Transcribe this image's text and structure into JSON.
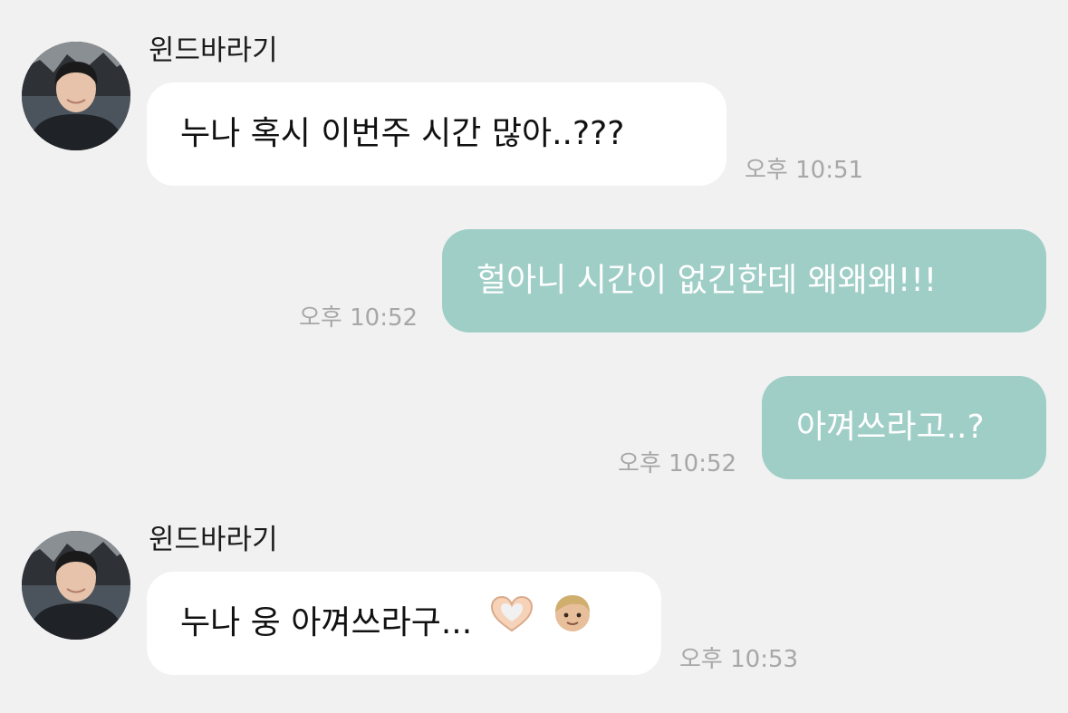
{
  "colors": {
    "background": "#f1f1f1",
    "incoming_bubble": "#ffffff",
    "outgoing_bubble": "#9fcec7",
    "timestamp": "#a7a7a7"
  },
  "messages": [
    {
      "direction": "incoming",
      "sender": "윈드바라기",
      "avatar": "profile-photo",
      "text": "누나 혹시 이번주 시간 많아..???",
      "time": "오후 10:51"
    },
    {
      "direction": "outgoing",
      "text": "헐아니 시간이 없긴한데 왜왜왜!!!",
      "time": "오후 10:52"
    },
    {
      "direction": "outgoing",
      "text": "아껴쓰라고..?",
      "time": "오후 10:52"
    },
    {
      "direction": "incoming",
      "sender": "윈드바라기",
      "avatar": "profile-photo",
      "text": "누나 웅 아껴쓰라구...",
      "emojis": [
        "heart-hands-emoji",
        "boy-emoji"
      ],
      "time": "오후 10:53"
    }
  ]
}
